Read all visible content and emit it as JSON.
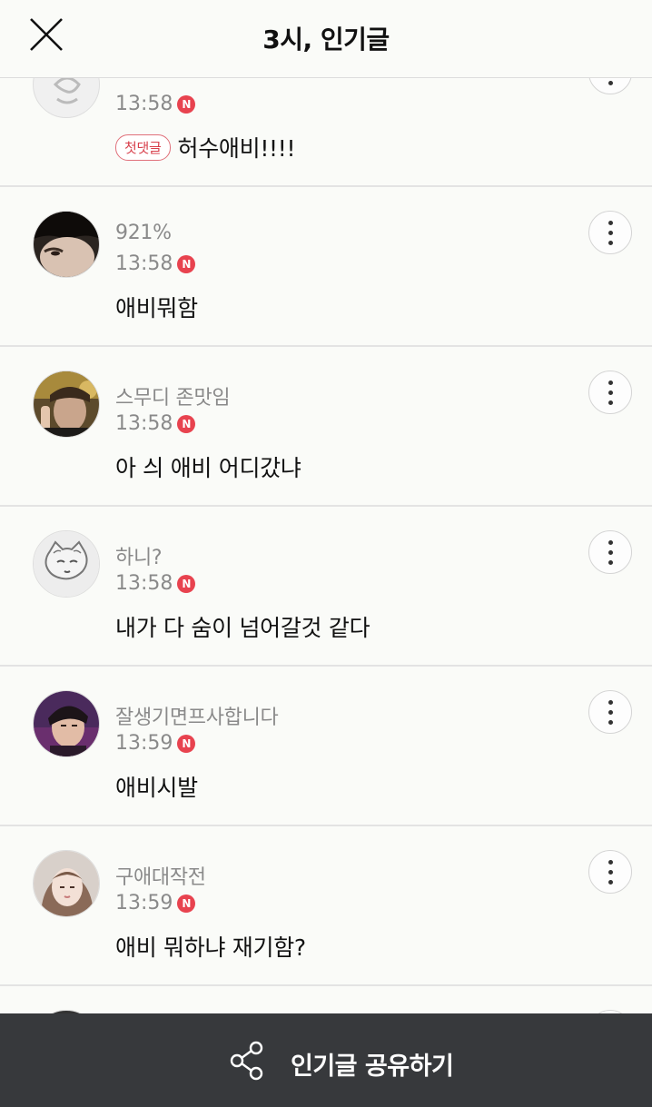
{
  "header": {
    "title": "3시, 인기글"
  },
  "comments": [
    {
      "username": "",
      "time": "13:58",
      "badge": "N",
      "tag": "첫댓글",
      "text": "허수애비!!!!"
    },
    {
      "username": "921%",
      "time": "13:58",
      "badge": "N",
      "text": "애비뭐함"
    },
    {
      "username": "스무디 존맛임",
      "time": "13:58",
      "badge": "N",
      "text": "아 싀 애비 어디갔냐"
    },
    {
      "username": "하니?",
      "time": "13:58",
      "badge": "N",
      "text": "내가 다 숨이 넘어갈것 같다"
    },
    {
      "username": "잘생기면프사합니다",
      "time": "13:59",
      "badge": "N",
      "text": "애비시발"
    },
    {
      "username": "구애대작전",
      "time": "13:59",
      "badge": "N",
      "text": "애비 뭐하냐 재기함?"
    }
  ],
  "bottom_bar": {
    "share_label": "인기글 공유하기"
  },
  "colors": {
    "badge": "#e8434f",
    "bar": "#37393c",
    "background": "#fafbf8"
  },
  "icons": [
    "close-icon",
    "more-vertical-icon",
    "share-icon"
  ]
}
